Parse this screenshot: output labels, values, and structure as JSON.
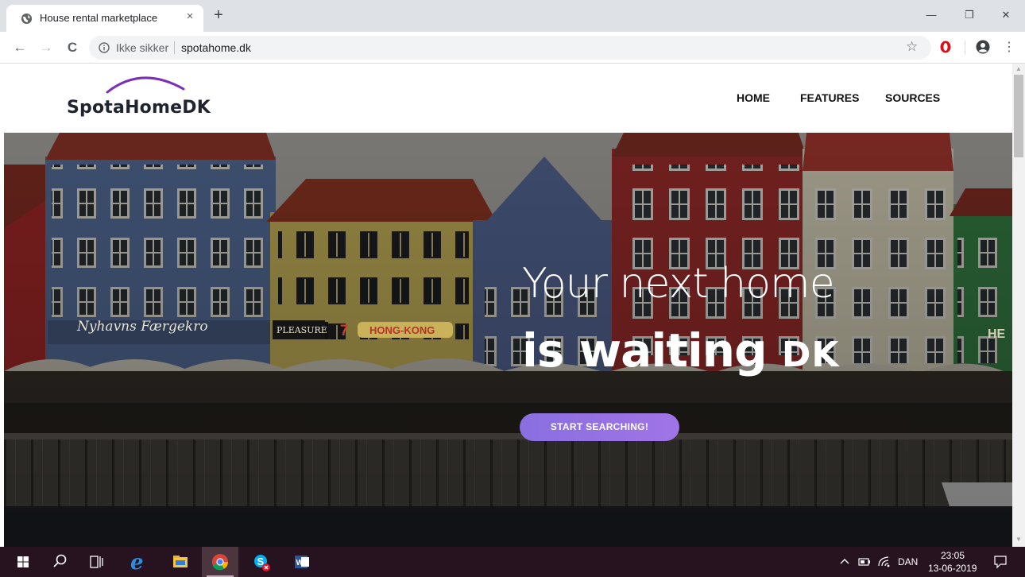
{
  "browser": {
    "tab_title": "House rental marketplace",
    "security_label": "Ikke sikker",
    "url": "spotahome.dk",
    "tab_close": "×",
    "new_tab": "+",
    "minimize": "—",
    "restore": "❐",
    "close": "✕",
    "back": "←",
    "forward": "→",
    "reload": "C",
    "star": "☆",
    "menu": "⋮"
  },
  "site": {
    "logo_text": "SpotaHomeDK",
    "nav": [
      "HOME",
      "FEATURES",
      "SOURCES"
    ],
    "hero": {
      "line1": "Your next home",
      "line2_main": "is waiting",
      "line2_suffix": "DK",
      "cta": "START SEARCHING!"
    }
  },
  "hero_signs": {
    "restaurant": "Nyhavns Færgekro",
    "pleasure": "PLEASURE",
    "hongkong": "HONG-KONG",
    "seven": "7",
    "he": "HE"
  },
  "taskbar": {
    "language": "DAN",
    "time": "23:05",
    "date": "13-06-2019"
  },
  "colors": {
    "cta_start": "#8a6fe0",
    "cta_end": "#a074e6",
    "logo_roof": "#7b2fb6",
    "taskbar": "#26131f"
  }
}
